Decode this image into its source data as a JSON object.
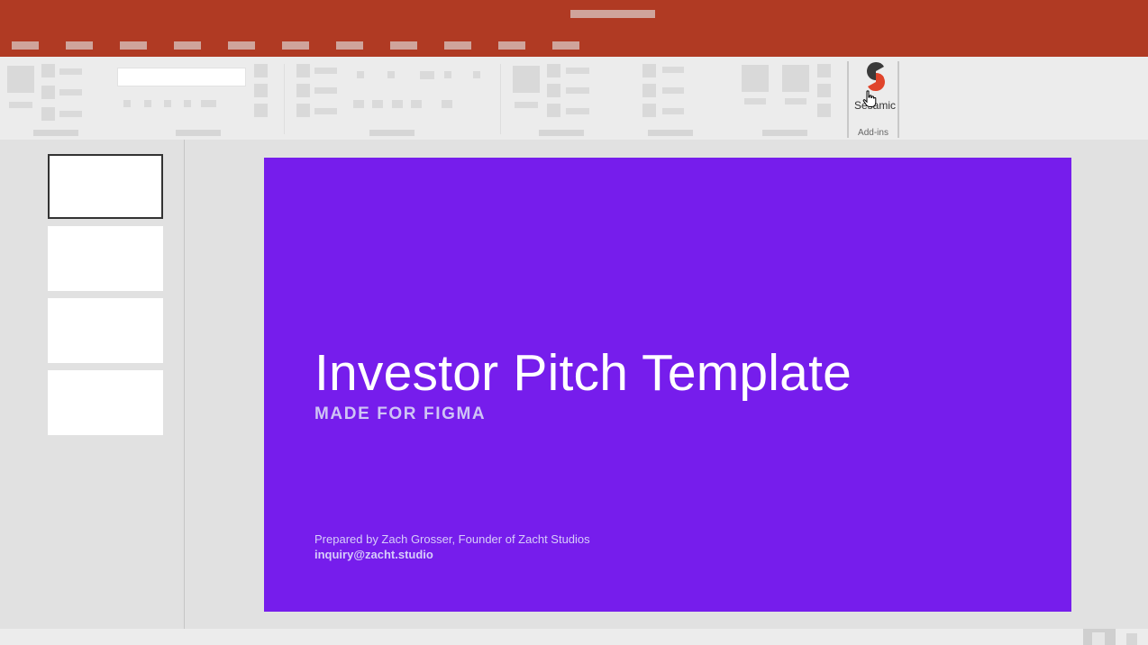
{
  "ribbon": {
    "addin": {
      "button_label": "Sesamic",
      "group_label": "Add-ins"
    }
  },
  "thumbnails": {
    "count": 4,
    "selected_index": 0
  },
  "slide": {
    "title": "Investor Pitch Template",
    "subtitle": "MADE FOR FIGMA",
    "byline": "Prepared by Zach Grosser, Founder of Zacht Studios",
    "email": "inquiry@zacht.studio",
    "background_color": "#761dec",
    "title_color": "#ffffff"
  },
  "colors": {
    "title_bar": "#b03a23",
    "ribbon": "#ececec",
    "workspace": "#e1e1e1",
    "logo_dark": "#3a3a3a",
    "logo_accent": "#e0442b"
  },
  "icons": {
    "addin_logo": "sesamic-logo-icon",
    "cursor": "hand-pointer-icon"
  }
}
